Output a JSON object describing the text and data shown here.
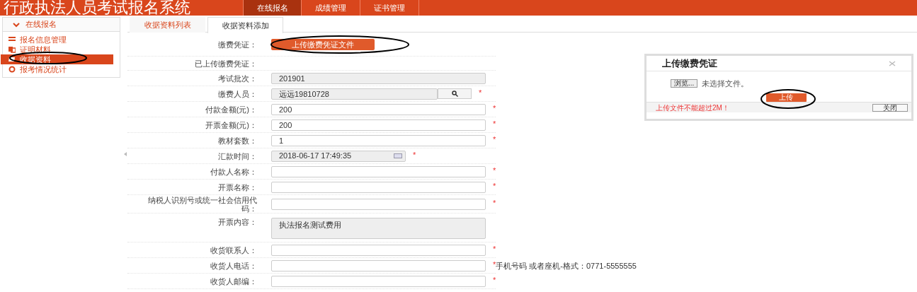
{
  "header": {
    "title": "行政执法人员考试报名系统",
    "nav": [
      {
        "label": "在线报名",
        "selected": true
      },
      {
        "label": "成绩管理",
        "selected": false
      },
      {
        "label": "证书管理",
        "selected": false
      }
    ]
  },
  "sidebar": {
    "title": "在线报名",
    "expanded": true,
    "items": [
      {
        "label": "报名信息管理",
        "kind": "list",
        "selected": false
      },
      {
        "label": "证明材料",
        "kind": "doc",
        "selected": false
      },
      {
        "label": "收据资料",
        "kind": "receipt",
        "selected": true
      },
      {
        "label": "报考情况统计",
        "kind": "stats",
        "selected": false
      }
    ]
  },
  "tabs": [
    {
      "label": "收据资料列表",
      "selected": false
    },
    {
      "label": "收据资料添加",
      "selected": true
    }
  ],
  "form": {
    "rows": [
      {
        "label": "缴费凭证：",
        "kind": "upload",
        "button": "上传缴费凭证文件"
      },
      {
        "label": "已上传缴费凭证：",
        "kind": "empty"
      },
      {
        "label": "考试批次：",
        "kind": "readonly",
        "value": "201901"
      },
      {
        "label": "缴费人员：",
        "kind": "search",
        "value": "远远19810728",
        "mark": "*"
      },
      {
        "label": "付款金额(元)：",
        "kind": "input",
        "value": "200",
        "mark": "*"
      },
      {
        "label": "开票金额(元)：",
        "kind": "input",
        "value": "200",
        "mark": "*"
      },
      {
        "label": "教材套数：",
        "kind": "input",
        "value": "1",
        "mark": "*"
      },
      {
        "label": "汇款时间：",
        "kind": "date",
        "value": "2018-06-17 17:49:35",
        "mark": "*"
      },
      {
        "label": "付款人名称：",
        "kind": "input",
        "mark": "*"
      },
      {
        "label": "开票名称：",
        "kind": "input",
        "mark": "*"
      },
      {
        "label": "纳税人识别号或统一社会信用代码：",
        "kind": "input",
        "mark": "*"
      },
      {
        "label": "开票内容：",
        "kind": "textarea",
        "value": "执法报名测试费用"
      },
      {
        "label": "收货联系人：",
        "kind": "input",
        "mark": "*"
      },
      {
        "label": "收货人电话：",
        "kind": "input",
        "mark": "*",
        "hint": "手机号码 或者座机-格式：0771-5555555"
      },
      {
        "label": "收货人邮编：",
        "kind": "input",
        "mark": "*"
      }
    ]
  },
  "dialog": {
    "title": "上传缴费凭证",
    "browse_button": "浏览...",
    "file_status": "未选择文件。",
    "upload_button": "上传",
    "warning": "上传文件不能超过2M！",
    "close_button": "关闭"
  }
}
